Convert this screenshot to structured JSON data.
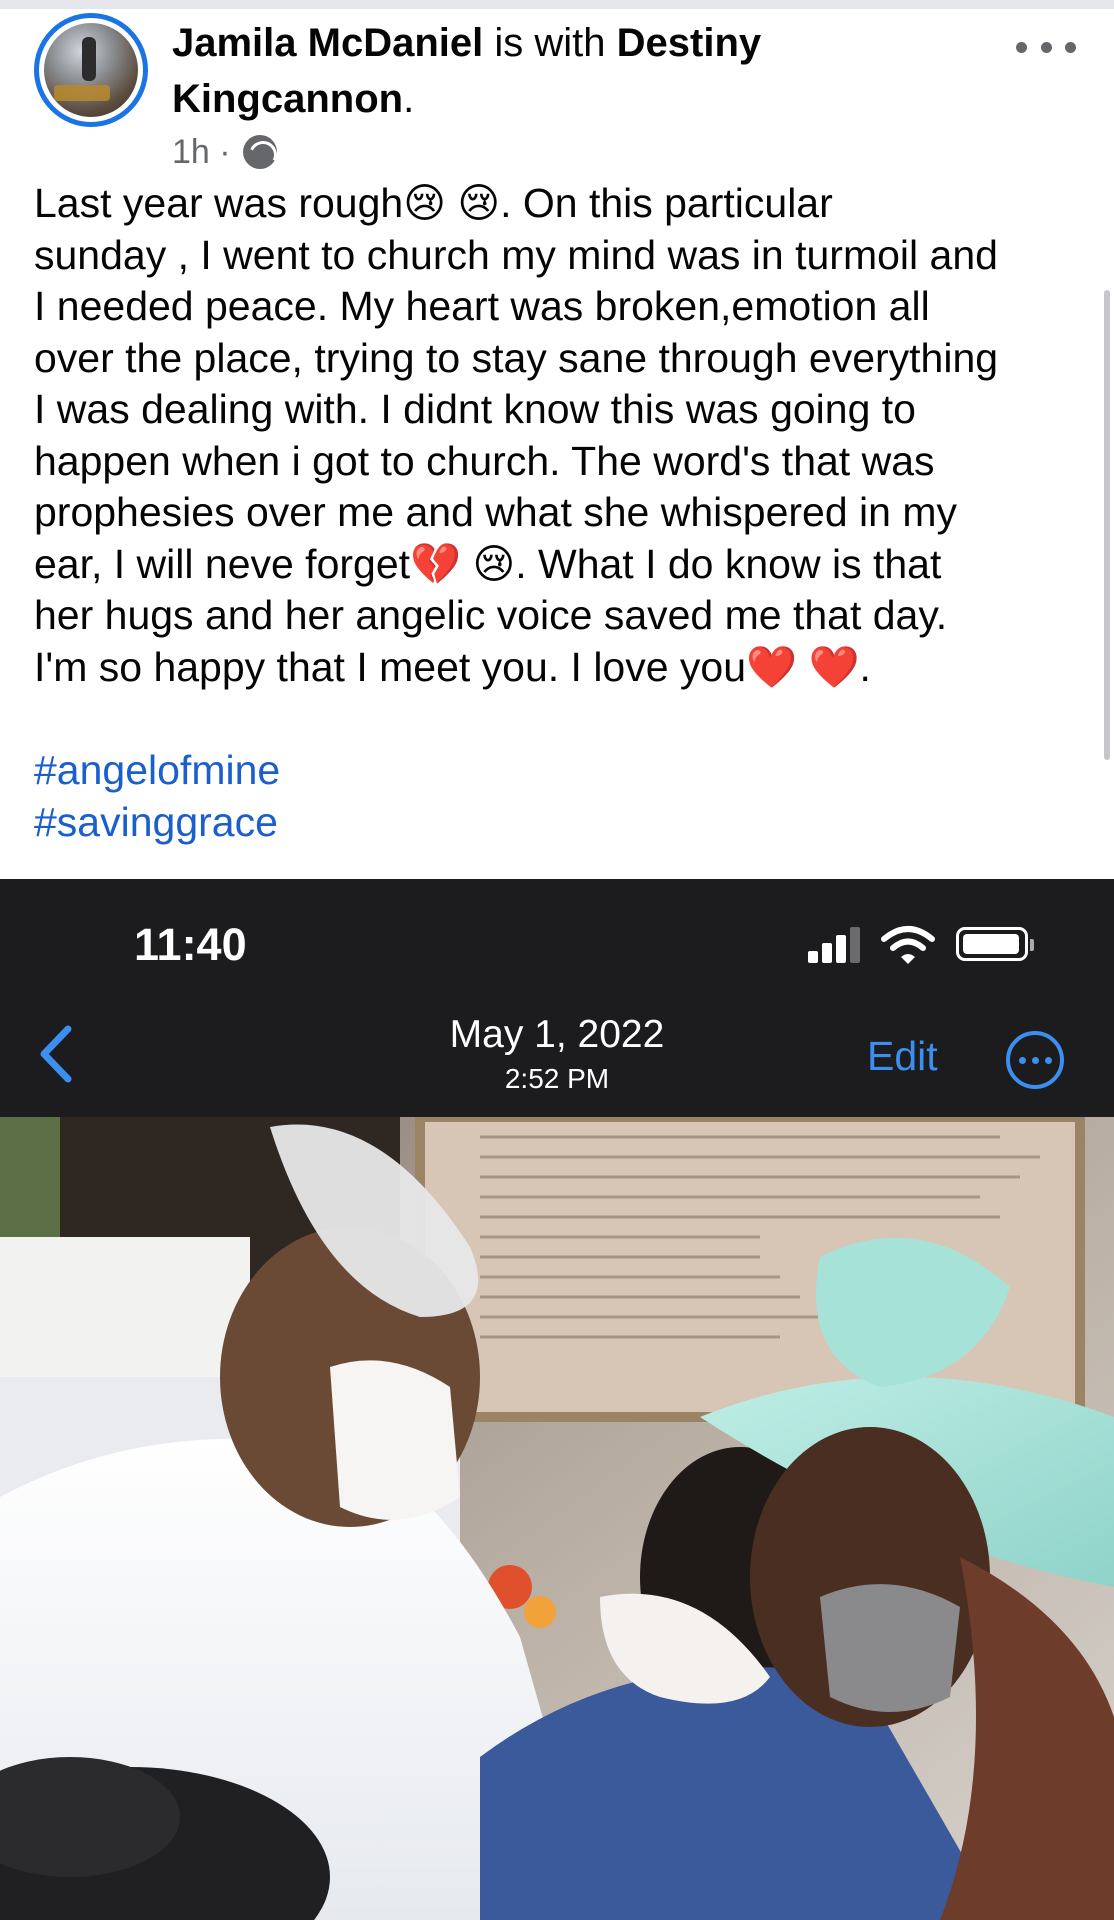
{
  "post": {
    "author": "Jamila McDaniel",
    "with_text": "is with",
    "tagged": "Destiny Kingcannon",
    "period": ".",
    "time": "1h ·",
    "body": "Last year was rough😢 😢. On this particular\nsunday , I went  to church my mind was in turmoil and\nI needed peace. My heart was broken,emotion all\nover the place, trying to stay sane through everything\nI was dealing with. I didnt know this was going to\nhappen when i got to church. The word's that was\nprophesies over me and what she whispered in my\near, I will neve forget💔 😢. What I do know is that\nher hugs and her angelic voice saved me that day.\nI'm so happy that I meet you. I love you❤️ ❤️.",
    "hashtags": [
      "#angelofmine",
      "#savinggrace"
    ]
  },
  "screenshot": {
    "status_time": "11:40",
    "date": "May 1, 2022",
    "time": "2:52 PM",
    "edit_label": "Edit"
  },
  "colors": {
    "link": "#1b5fcc",
    "ios_accent": "#3b8ff0",
    "dark_bar": "#1c1c1e"
  },
  "icons": [
    "more-horizontal-icon",
    "globe-icon",
    "signal-icon",
    "wifi-icon",
    "battery-icon",
    "chevron-left-icon",
    "more-circle-icon"
  ]
}
